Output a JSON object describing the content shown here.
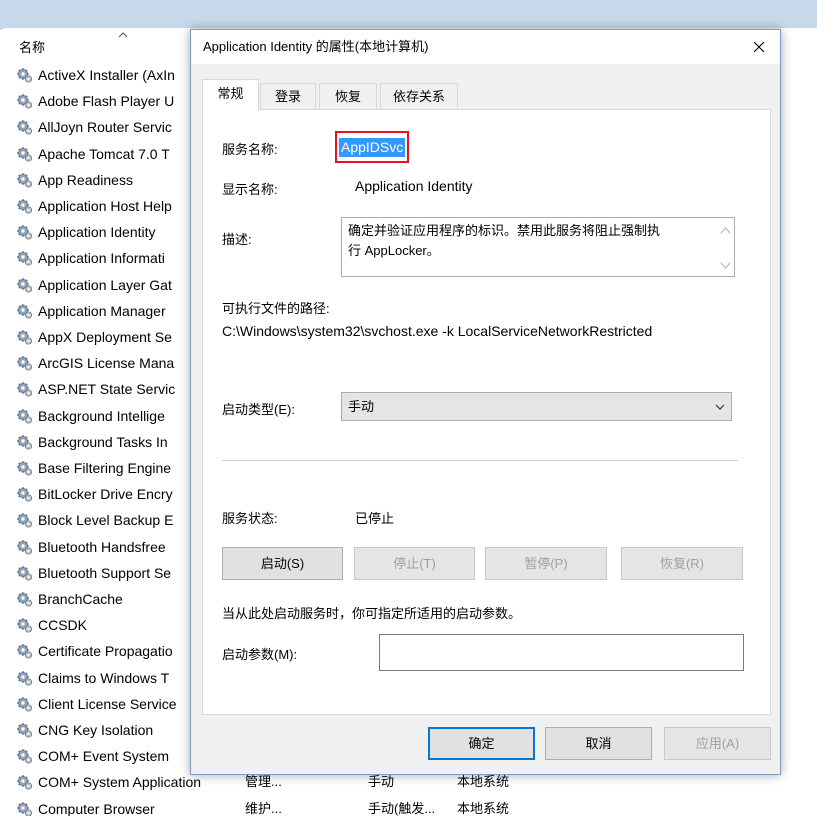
{
  "services": {
    "column_header": "名称",
    "rows": [
      {
        "name": "ActiveX Installer (AxIn"
      },
      {
        "name": "Adobe Flash Player U"
      },
      {
        "name": "AllJoyn Router Servic"
      },
      {
        "name": "Apache Tomcat 7.0 T"
      },
      {
        "name": "App Readiness"
      },
      {
        "name": "Application Host Help"
      },
      {
        "name": "Application Identity"
      },
      {
        "name": "Application Informati"
      },
      {
        "name": "Application Layer Gat"
      },
      {
        "name": "Application Manager"
      },
      {
        "name": "AppX Deployment Se"
      },
      {
        "name": "ArcGIS License Mana"
      },
      {
        "name": "ASP.NET State Servic"
      },
      {
        "name": "Background Intellige"
      },
      {
        "name": "Background Tasks In"
      },
      {
        "name": "Base Filtering Engine"
      },
      {
        "name": "BitLocker Drive Encry"
      },
      {
        "name": "Block Level Backup E"
      },
      {
        "name": "Bluetooth Handsfree"
      },
      {
        "name": "Bluetooth Support Se"
      },
      {
        "name": "BranchCache"
      },
      {
        "name": "CCSDK"
      },
      {
        "name": "Certificate Propagatio"
      },
      {
        "name": "Claims to Windows T"
      },
      {
        "name": "Client License Service"
      },
      {
        "name": "CNG Key Isolation"
      },
      {
        "name": "COM+ Event System"
      },
      {
        "name": "COM+ System Application",
        "description": "管理...",
        "startup": "手动",
        "logon": "本地系统"
      },
      {
        "name": "Computer Browser",
        "description": "维护...",
        "startup": "手动(触发...",
        "logon": "本地系统"
      }
    ]
  },
  "dialog": {
    "title": "Application Identity 的属性(本地计算机)",
    "tabs": [
      "常规",
      "登录",
      "恢复",
      "依存关系"
    ],
    "general": {
      "service_name_label": "服务名称:",
      "service_name": "AppIDSvc",
      "display_name_label": "显示名称:",
      "display_name": "Application Identity",
      "description_label": "描述:",
      "description_line1": "确定并验证应用程序的标识。禁用此服务将阻止强制执",
      "description_line2": "行 AppLocker。",
      "path_label": "可执行文件的路径:",
      "path": "C:\\Windows\\system32\\svchost.exe -k LocalServiceNetworkRestricted",
      "startup_type_label": "启动类型(E):",
      "startup_type": "手动",
      "status_label": "服务状态:",
      "status": "已停止",
      "start_button": "启动(S)",
      "stop_button": "停止(T)",
      "pause_button": "暂停(P)",
      "resume_button": "恢复(R)",
      "hint": "当从此处启动服务时，你可指定所适用的启动参数。",
      "params_label": "启动参数(M):",
      "params_value": ""
    },
    "ok_button": "确定",
    "cancel_button": "取消",
    "apply_button": "应用(A)"
  }
}
